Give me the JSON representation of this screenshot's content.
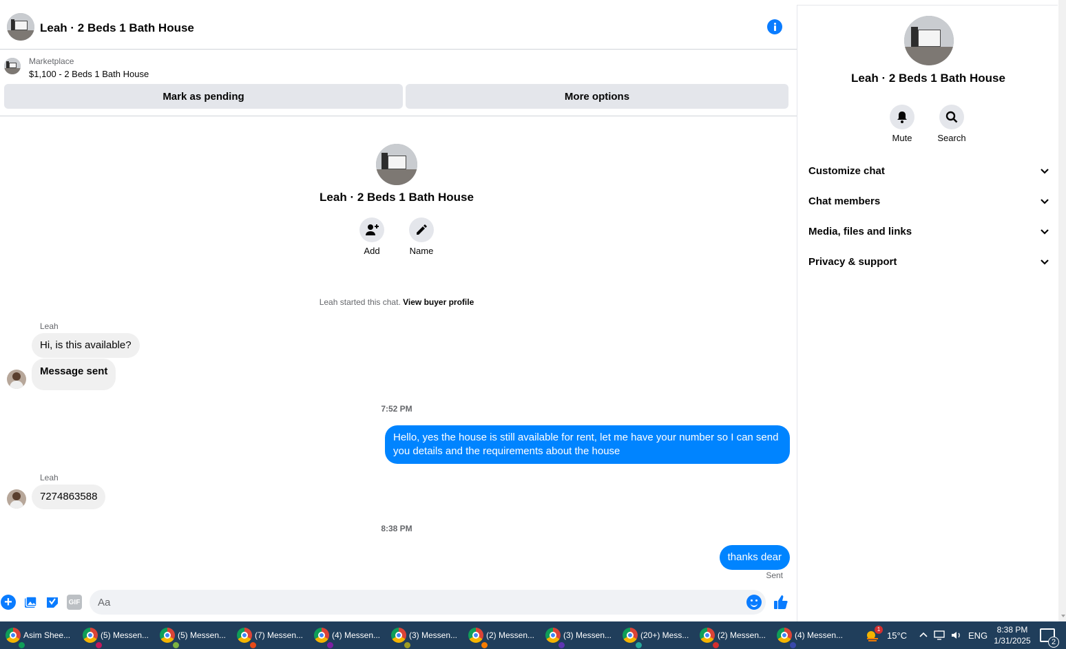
{
  "chat": {
    "title": "Leah · 2 Beds 1 Bath House",
    "marketplace_label": "Marketplace",
    "listing": "$1,100 - 2 Beds 1 Bath House",
    "mark_pending_label": "Mark as pending",
    "more_options_label": "More options",
    "intro_title": "Leah · 2 Beds 1 Bath House",
    "add_label": "Add",
    "name_label": "Name",
    "started_text": "Leah started this chat.",
    "view_buyer_label": "View buyer profile",
    "messages": {
      "sender1": "Leah",
      "in1": "Hi, is this available?",
      "in2": "Message sent",
      "time1": "7:52 PM",
      "out1": "Hello, yes the house is still available for rent, let me have your number so I can send you details and the requirements about the house",
      "sender2": "Leah",
      "in3": "7274863588",
      "time2": "8:38 PM",
      "out2": "thanks dear",
      "status": "Sent"
    },
    "composer_placeholder": "Aa",
    "gif_label": "GIF"
  },
  "side": {
    "title": "Leah · 2 Beds 1 Bath House",
    "mute_label": "Mute",
    "search_label": "Search",
    "sections": [
      "Customize chat",
      "Chat members",
      "Media, files and links",
      "Privacy & support"
    ]
  },
  "taskbar": {
    "tasks": [
      "Asim Shee...",
      "(5) Messen...",
      "(5) Messen...",
      "(7) Messen...",
      "(4) Messen...",
      "(3) Messen...",
      "(2) Messen...",
      "(3) Messen...",
      "(20+) Mess...",
      "(2) Messen...",
      "(4) Messen..."
    ],
    "weather_badge": "1",
    "temperature": "15°C",
    "language": "ENG",
    "time": "8:38 PM",
    "date": "1/31/2025",
    "notification_count": "2"
  },
  "colors": {
    "accent": "#0a7cff",
    "bubble_out": "#0084ff",
    "taskbar": "#203e5b"
  }
}
